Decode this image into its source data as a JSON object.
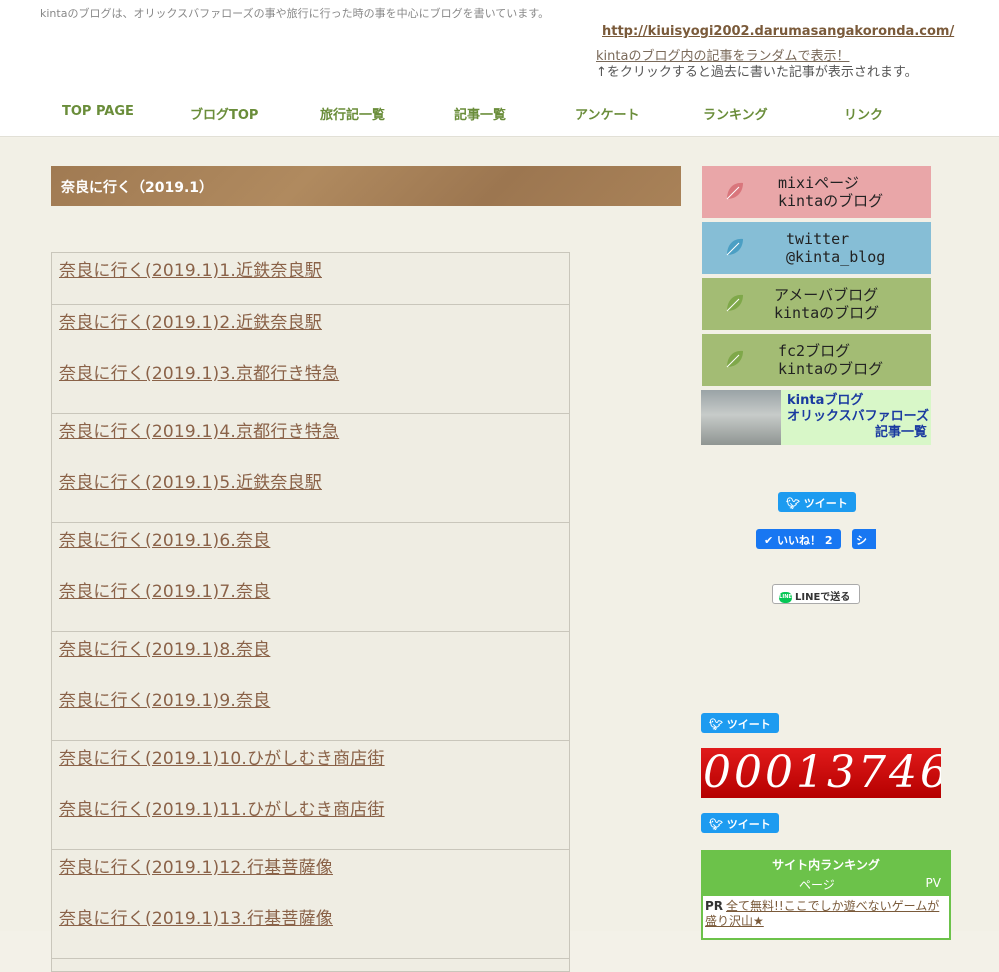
{
  "header": {
    "tagline": "kintaのブログは、オリックスバファローズの事や旅行に行った時の事を中心にブログを書いています。",
    "site_url": "http://kiuisyogi2002.darumasangakoronda.com/",
    "random_link": "kintaのブログ内の記事をランダムで表示！",
    "random_note": "↑をクリックすると過去に書いた記事が表示されます。"
  },
  "nav": {
    "items": [
      {
        "label": "TOP PAGE"
      },
      {
        "label": "ブログTOP"
      },
      {
        "label": "旅行記一覧"
      },
      {
        "label": "記事一覧"
      },
      {
        "label": "アンケート"
      },
      {
        "label": "ランキング"
      },
      {
        "label": "リンク"
      }
    ]
  },
  "main": {
    "title": "奈良に行く（2019.1）",
    "rows": [
      [
        "奈良に行く(2019.1)1.近鉄奈良駅"
      ],
      [
        "奈良に行く(2019.1)2.近鉄奈良駅",
        "奈良に行く(2019.1)3.京都行き特急"
      ],
      [
        "奈良に行く(2019.1)4.京都行き特急",
        "奈良に行く(2019.1)5.近鉄奈良駅"
      ],
      [
        "奈良に行く(2019.1)6.奈良",
        "奈良に行く(2019.1)7.奈良"
      ],
      [
        "奈良に行く(2019.1)8.奈良",
        "奈良に行く(2019.1)9.奈良"
      ],
      [
        "奈良に行く(2019.1)10.ひがしむき商店街",
        "奈良に行く(2019.1)11.ひがしむき商店街"
      ],
      [
        "奈良に行く(2019.1)12.行基菩薩像",
        "奈良に行く(2019.1)13.行基菩薩像"
      ]
    ]
  },
  "sidebar": {
    "banners": [
      {
        "line1": "mixiページ",
        "line2": "kintaのブログ",
        "leaf_color": "#d9767c"
      },
      {
        "line1": "twitter",
        "line2": "@kinta_blog",
        "leaf_color": "#4b9fc4"
      },
      {
        "line1": "アメーバブログ",
        "line2": "kintaのブログ",
        "leaf_color": "#7fa84a"
      },
      {
        "line1": "fc2ブログ",
        "line2": "kintaのブログ",
        "leaf_color": "#7fa84a"
      }
    ],
    "orix": {
      "line1": "kintaブログ",
      "line2": "オリックスバファローズ",
      "line3": "記事一覧"
    },
    "tweet_label": "ツイート",
    "like_label": "いいね！ 2",
    "share_label": "シェ",
    "line_label": "LINEで送る",
    "counter": "00013746",
    "ranking": {
      "title": "サイト内ランキング",
      "col_page": "ページ",
      "col_pv": "PV",
      "pr_tag": "PR",
      "pr_text": "全て無料!!ここでしか遊べないゲームが盛り沢山★"
    }
  },
  "colors": {
    "nav_text": "#6a8d3a",
    "link": "#8a6248",
    "counter_red": "#c00000",
    "ranking_green": "#6cc24a"
  }
}
